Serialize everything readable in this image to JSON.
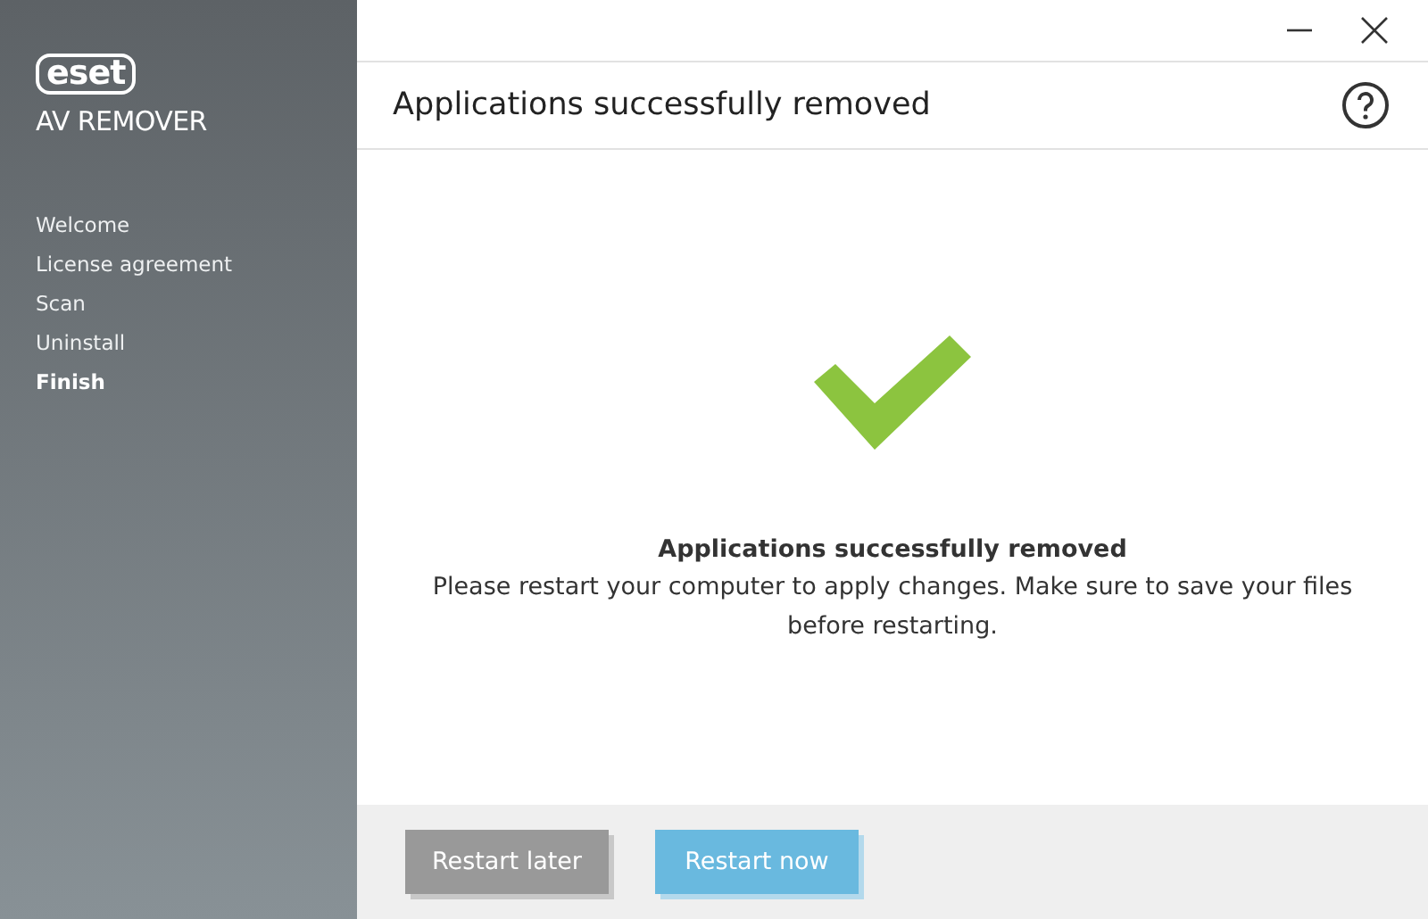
{
  "sidebar": {
    "logo": "eset",
    "product": "AV REMOVER",
    "steps": [
      {
        "label": "Welcome",
        "selected": false
      },
      {
        "label": "License agreement",
        "selected": false
      },
      {
        "label": "Scan",
        "selected": false
      },
      {
        "label": "Uninstall",
        "selected": false
      },
      {
        "label": "Finish",
        "selected": true
      }
    ]
  },
  "header": {
    "title": "Applications successfully removed"
  },
  "result": {
    "heading": "Applications successfully removed",
    "message": "Please restart your computer to apply changes. Make sure to save your files before restarting."
  },
  "buttons": [
    {
      "label": "Restart later",
      "kind": "secondary"
    },
    {
      "label": "Restart now",
      "kind": "primary"
    }
  ]
}
